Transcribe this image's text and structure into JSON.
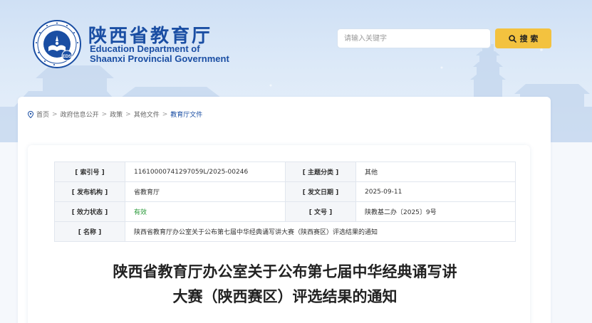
{
  "header": {
    "title_cn": "陕西省教育厅",
    "title_en_line1": "Education Department of",
    "title_en_line2": "Shaanxi Provincial Government",
    "logo_text": "EDS"
  },
  "search": {
    "placeholder": "请输入关键字",
    "button_label": "搜 索"
  },
  "breadcrumb": {
    "items": [
      "首页",
      "政府信息公开",
      "政策",
      "其他文件",
      "教育厅文件"
    ],
    "separator": ">"
  },
  "meta": {
    "rows": [
      [
        {
          "label": "[ 索引号 ]",
          "value": "11610000741297059L/2025-00246"
        },
        {
          "label": "[ 主题分类 ]",
          "value": "其他"
        }
      ],
      [
        {
          "label": "[ 发布机构 ]",
          "value": "省教育厅"
        },
        {
          "label": "[ 发文日期 ]",
          "value": "2025-09-11"
        }
      ],
      [
        {
          "label": "[ 效力状态 ]",
          "value": "有效"
        },
        {
          "label": "[ 文号 ]",
          "value": "陕教基二办〔2025〕9号"
        }
      ]
    ],
    "name_label": "[ 名称 ]",
    "name_value": "陕西省教育厅办公室关于公布第七届中华经典诵写讲大赛（陕西赛区）评选结果的通知"
  },
  "document": {
    "title_line1": "陕西省教育厅办公室关于公布第七届中华经典诵写讲",
    "title_line2": "大赛（陕西赛区）评选结果的通知"
  },
  "icons": {
    "logo": "emblem-icon",
    "search": "search-icon",
    "location": "location-pin-icon"
  },
  "colors": {
    "brand": "#1a4ea3",
    "search_button": "#f3c23f",
    "status_valid": "#2a9a3a"
  }
}
